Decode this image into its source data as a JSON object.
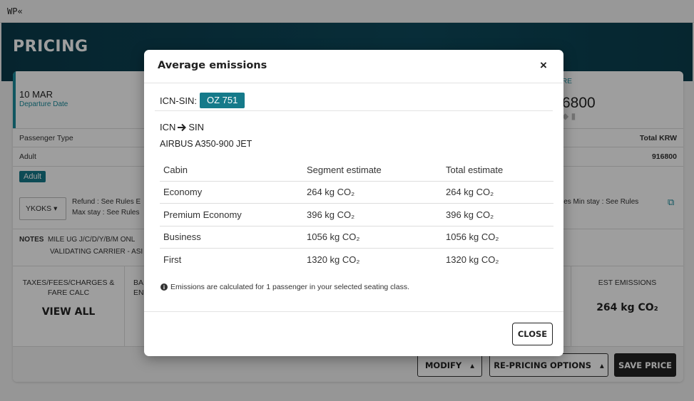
{
  "topbar": {
    "label": "WP«"
  },
  "page": {
    "title": "PRICING"
  },
  "summary": {
    "departure_date": "10 MAR",
    "departure_label": "Departure Date",
    "fare_label": "RE",
    "fare_amount": "6800"
  },
  "table_header": {
    "passenger_type": "Passenger Type",
    "total": "Total KRW"
  },
  "table_row": {
    "type": "Adult",
    "total": "916800"
  },
  "adult_tag": "Adult",
  "fare_basis": {
    "code": "YKOKS",
    "refund": "Refund : See Rules",
    "refund_cut": "E",
    "max_stay": "Max stay : See Rules",
    "right_rules": "les   Min stay : See Rules"
  },
  "notes": {
    "label": "NOTES",
    "line1": "MILE UG J/C/D/Y/B/M ONL",
    "line2": "VALIDATING CARRIER - ASI"
  },
  "tiles": {
    "taxes_label_1": "TAXES/FEES/CHARGES &",
    "taxes_label_2": "FARE CALC",
    "taxes_value": "VIEW ALL",
    "bag_label_1": "BA",
    "bag_label_2": "EN",
    "emissions_label": "EST EMISSIONS",
    "emissions_value": "264 kg CO₂"
  },
  "buttons": {
    "modify": "MODIFY",
    "repricing": "RE-PRICING OPTIONS",
    "save": "SAVE PRICE"
  },
  "modal": {
    "title": "Average emissions",
    "close_x": "×",
    "route_label": "ICN-SIN:",
    "flight": "OZ 751",
    "from": "ICN",
    "to": "SIN",
    "aircraft": "AIRBUS A350-900 JET",
    "columns": [
      "Cabin",
      "Segment estimate",
      "Total estimate"
    ],
    "rows": [
      {
        "cabin": "Economy",
        "segment": "264 kg CO₂",
        "total": "264 kg CO₂"
      },
      {
        "cabin": "Premium Economy",
        "segment": "396 kg CO₂",
        "total": "396 kg CO₂"
      },
      {
        "cabin": "Business",
        "segment": "1056 kg CO₂",
        "total": "1056 kg CO₂"
      },
      {
        "cabin": "First",
        "segment": "1320 kg CO₂",
        "total": "1320 kg CO₂"
      }
    ],
    "info_text": "Emissions are calculated for 1 passenger in your selected seating class.",
    "close_button": "CLOSE"
  },
  "colors": {
    "accent": "#157a8a",
    "hero": "#0d4a5c"
  }
}
